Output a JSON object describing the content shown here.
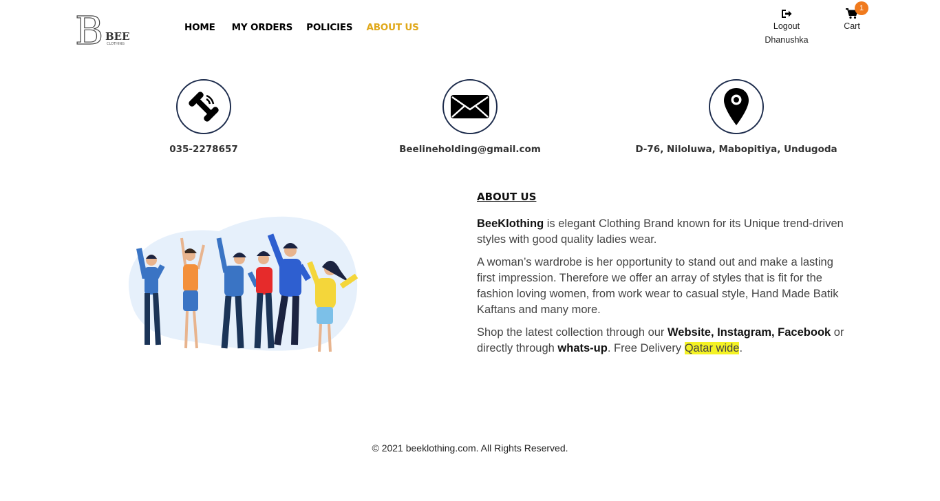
{
  "header": {
    "logo_text": "BEE",
    "logo_subtext": "CLOTHING",
    "nav": [
      {
        "label": "HOME"
      },
      {
        "label": "MY ORDERS"
      },
      {
        "label": "POLICIES"
      },
      {
        "label": "ABOUT US"
      }
    ],
    "user": {
      "action_label": "Logout",
      "username": "Dhanushka",
      "icon": "logout-icon"
    },
    "cart": {
      "label": "Cart",
      "count": "1",
      "icon": "cart-icon"
    },
    "active_color": "#e0a81a",
    "badge_color": "#f07a1d"
  },
  "contact": {
    "phone": {
      "icon": "phone-icon",
      "text": "035-2278657"
    },
    "email": {
      "icon": "envelope-icon",
      "text": "Beelineholding@gmail.com"
    },
    "address": {
      "icon": "location-pin-icon",
      "text": "D-76, Niloluwa, Mabopitiya, Undugoda"
    }
  },
  "about": {
    "heading": "ABOUT US",
    "p1_brand": "BeeKlothing",
    "p1_rest": " is elegant Clothing Brand known for its Unique trend-driven styles with good quality ladies wear.",
    "p2": "A woman’s wardrobe is her opportunity to stand out and make a lasting first impression. Therefore we offer an array of styles that is fit for the fashion loving women, from work wear to casual style, Hand Made Batik Kaftans and many more.",
    "p3_a": "Shop the latest collection through our ",
    "p3_channels": "Website, Instagram, Facebook",
    "p3_b": " or directly through ",
    "p3_whatsapp": "whats-up",
    "p3_c": ". Free Delivery ",
    "p3_highlight": "Qatar wide",
    "p3_d": ".",
    "highlight_color": "#f4f224"
  },
  "footer": {
    "text": "© 2021 beeklothing.com. All Rights Reserved."
  }
}
